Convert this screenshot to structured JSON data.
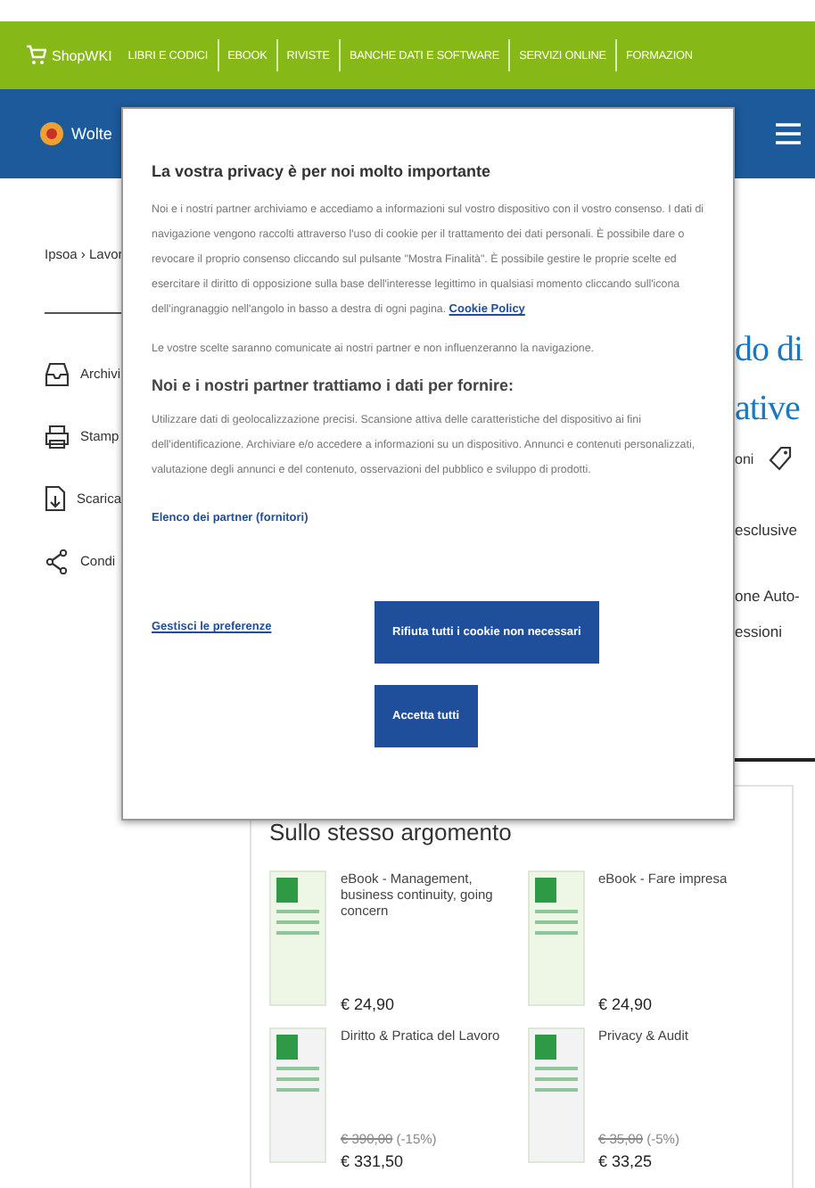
{
  "top_bar": {
    "brand": "ShopWKI",
    "nav": [
      "LIBRI E CODICI",
      "EBOOK",
      "RIVISTE",
      "BANCHE DATI E SOFTWARE",
      "SERVIZI ONLINE",
      "FORMAZION"
    ]
  },
  "header": {
    "logo_text": "Wolte"
  },
  "breadcrumb": "Ipsoa › Lavor",
  "sidebar_actions": [
    {
      "kind": "archive",
      "label": "Archivi"
    },
    {
      "kind": "print",
      "label": "Stamp"
    },
    {
      "kind": "download",
      "label": "Scarica"
    },
    {
      "kind": "share",
      "label": "Condi"
    }
  ],
  "article": {
    "title_lines": [
      "do di",
      "ative"
    ],
    "meta": "oni",
    "lines": [
      "esclusive",
      "one Auto-",
      "essioni"
    ]
  },
  "cookie_dialog": {
    "title": "La vostra privacy è per noi molto importante",
    "intro": "Noi e i nostri partner archiviamo e accediamo a informazioni sul vostro dispositivo con il vostro consenso. I dati di navigazione vengono raccolti attraverso l'uso di cookie per il trattamento dei dati personali. È possibile dare o revocare il proprio consenso cliccando sul pulsante \"Mostra Finalità\". È possibile gestire le proprie scelte ed esercitare il diritto di opposizione sulla base dell'interesse legittimo in qualsiasi momento cliccando sull'icona dell'ingranaggio nell'angolo in basso a destra di ogni pagina.",
    "policy_link": "Cookie Policy",
    "note": "Le vostre scelte saranno comunicate ai nostri partner e non influenzeranno la navigazione.",
    "purposes_title": "Noi e i nostri partner trattiamo i dati per fornire:",
    "purposes": "Utilizzare dati di geolocalizzazione precisi. Scansione attiva delle caratteristiche del dispositivo ai fini dell'identificazione. Archiviare e/o accedere a informazioni su un dispositivo. Annunci e contenuti personalizzati, valutazione degli annunci e del contenuto, osservazioni del pubblico e sviluppo di prodotti.",
    "partners_link": "Elenco dei partner (fornitori)",
    "manage_link": "Gestisci le preferenze",
    "reject_button": "Rifiuta tutti i cookie non necessari",
    "accept_button": "Accetta tutti"
  },
  "related": {
    "title": "Sullo stesso argomento",
    "products": [
      {
        "title": "eBook - Management, business continuity, going concern",
        "price": "€ 24,90"
      },
      {
        "title": "eBook - Fare impresa",
        "price": "€ 24,90"
      },
      {
        "title": "Diritto & Pratica del Lavoro",
        "old_price": "€ 390,00",
        "discount": "(-15%)",
        "price": "€ 331,50"
      },
      {
        "title": "Privacy & Audit",
        "old_price": "€ 35,00",
        "discount": "(-5%)",
        "price": "€ 33,25"
      }
    ]
  }
}
